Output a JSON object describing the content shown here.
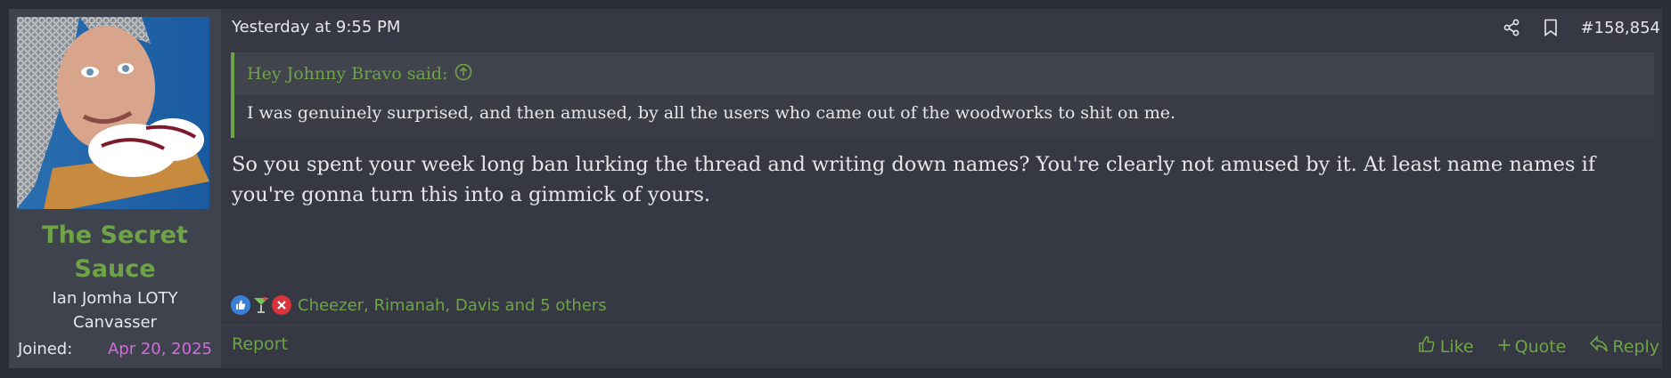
{
  "user": {
    "name": "The Secret Sauce",
    "title_line1": "Ian Jomha LOTY",
    "title_line2": "Canvasser",
    "joined_label": "Joined:",
    "joined_date": "Apr 20, 2025"
  },
  "post": {
    "date": "Yesterday at 9:55 PM",
    "number": "#158,854",
    "quote_author": "Hey Johnny Bravo said:",
    "quote_text": "I was genuinely surprised, and then amused, by all the users who came out of the woodworks to shit on me.",
    "body": "So you spent your week long ban lurking the thread and writing down names? You're clearly not amused by it. At least name names if you're gonna turn this into a gimmick of yours.",
    "reactions": {
      "icons": [
        "thumbs-up-icon",
        "cocktail-icon",
        "x-icon"
      ],
      "names": "Cheezer, Rimanah, Davis and 5 others"
    }
  },
  "footer": {
    "report": "Report",
    "like": "Like",
    "quote": "Quote",
    "reply": "Reply"
  },
  "colors": {
    "accent": "#6ea347",
    "joined_date": "#d36bdc",
    "background": "#363943"
  }
}
